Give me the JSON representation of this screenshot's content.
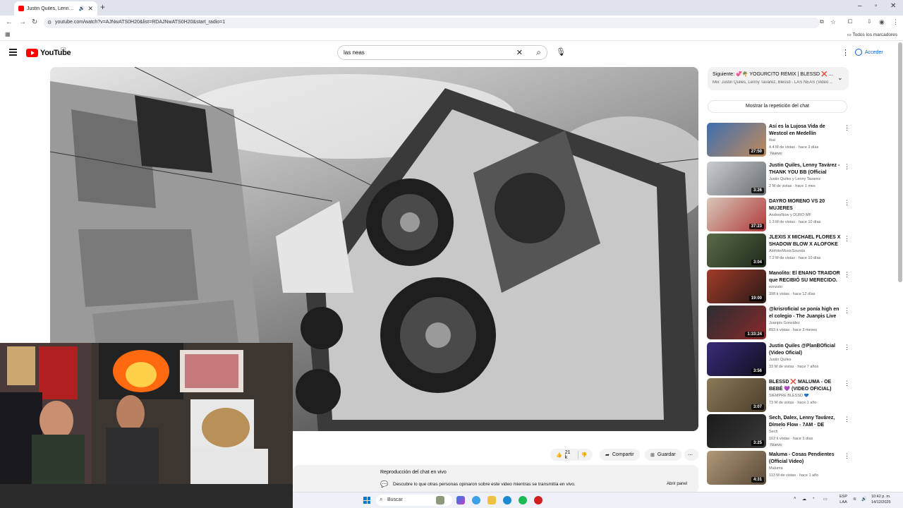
{
  "browser": {
    "tab_title": "Justin Quiles, Lenny Tavárez",
    "new_tab": "+",
    "url": "youtube.com/watch?v=AJNwATS0H20&list=RDAJNwATS0H20&start_radio=1",
    "bookmarks_label": "Todos los marcadores"
  },
  "youtube": {
    "logo_text": "YouTube",
    "country_code": "CO",
    "search_value": "las neas",
    "sign_in_label": "Acceder",
    "colors": {
      "brand_red": "#ff0000",
      "link_blue": "#065fd4"
    }
  },
  "actions": {
    "likes": "21 k",
    "share_label": "Compartir",
    "save_label": "Guardar"
  },
  "live_chat": {
    "title": "Reproducción del chat en vivo",
    "description": "Descubre lo que otras personas opinaron sobre este video mientras se transmitía en vivo.",
    "open_panel_label": "Abrir panel"
  },
  "mix": {
    "next_label": "Siguiente: 💞🌴 YOGURCITO REMIX | BLESSD ❌ ...",
    "subtitle": "Mix: Justin Quiles, Lenny Tavárez, Blessd - LAS NEAS (Video ..."
  },
  "show_chat_label": "Mostrar la repetición del chat",
  "recommendations": [
    {
      "title": "Así es la Lujosa Vida de Westcol en Medellín",
      "channel": "Ibai",
      "views": "4.4 M de vistas · hace 3 días",
      "badge": "Nuevo",
      "duration": "27:50",
      "thumb": [
        "#3d6fb0",
        "#c28a5a"
      ]
    },
    {
      "title": "Justin Quiles, Lenny Tavárez - THANK YOU BB (Official Video)",
      "channel": "Justin Quiles y Lenny Tavarez",
      "views": "2 M de vistas · hace 1 mes",
      "badge": "",
      "duration": "3:26",
      "thumb": [
        "#c9cdd0",
        "#6a6f74"
      ]
    },
    {
      "title": "DAYRO MORENO VS 20 MUJERES",
      "channel": "AndresNow y DURO MF",
      "views": "1.3 M de vistas · hace 10 días",
      "badge": "",
      "duration": "37:23",
      "thumb": [
        "#d8c7b8",
        "#b03a3a"
      ]
    },
    {
      "title": "JLEXIS X MICHAEL FLORES X SHADOW BLOW X ALOFOKE ...",
      "channel": "AlofokeMusicSounds",
      "views": "7.2 M de vistas · hace 10 días",
      "badge": "",
      "duration": "3:04",
      "thumb": [
        "#5a6a48",
        "#1f2a1c"
      ]
    },
    {
      "title": "Manolito: El ENANO TRAIDOR que RECIBIÓ SU MERECIDO.",
      "channel": "eznzsto",
      "views": "398 k vistas · hace 12 días",
      "badge": "",
      "duration": "19:00",
      "thumb": [
        "#a23b2a",
        "#2a1a16"
      ]
    },
    {
      "title": "@krisroficial se ponía high en el colegio - The Juanpis Live Show",
      "channel": "Juanpis González",
      "views": "893 k vistas · hace 3 meses",
      "badge": "",
      "duration": "1:33:24",
      "thumb": [
        "#2a2d33",
        "#8a2a2a"
      ]
    },
    {
      "title": "Justin Quiles @PlanBOficial (Video Oficial)",
      "channel": "Justin Quiles",
      "views": "33 M de vistas · hace 7 años",
      "badge": "",
      "duration": "3:56",
      "thumb": [
        "#3a2a7a",
        "#101020"
      ]
    },
    {
      "title": "BLESSD ❌ MALUMA - OE BEBÉ 💜 (VIDEO OFICIAL)",
      "channel": "SIEMPRE BLESSD 💙",
      "views": "73 M de vistas · hace 1 año",
      "badge": "",
      "duration": "3:07",
      "thumb": [
        "#8a7a58",
        "#4a3e2a"
      ]
    },
    {
      "title": "Sech, Dalex, Lenny Tavárez, Dímelo Flow - 7AM · DE MISIÓ...",
      "channel": "Sech",
      "views": "162 k vistas · hace 3 días",
      "badge": "Nuevo",
      "duration": "3:25",
      "thumb": [
        "#1a1a1a",
        "#3a3a3a"
      ]
    },
    {
      "title": "Maluma - Cosas Pendientes (Official Video)",
      "channel": "Maluma",
      "views": "113 M de vistas · hace 1 año",
      "badge": "",
      "duration": "4:31",
      "thumb": [
        "#b09878",
        "#5a4a38"
      ]
    }
  ],
  "taskbar": {
    "search_placeholder": "Buscar",
    "lang_top": "ESP",
    "lang_bottom": "LAA",
    "time": "10:42 p. m.",
    "date": "14/12/2025"
  }
}
